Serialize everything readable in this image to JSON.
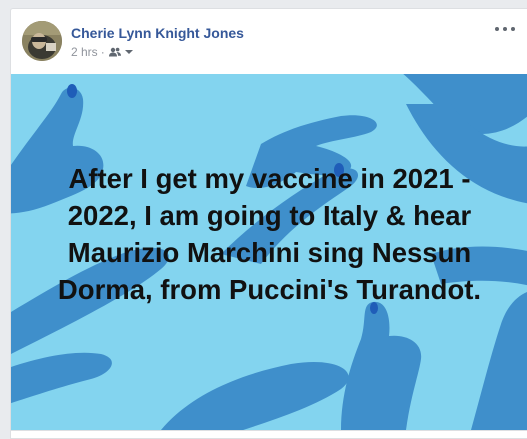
{
  "post": {
    "author": "Cherie Lynn Knight Jones",
    "time": "2 hrs",
    "separator": "·",
    "audience_icon": "friends-icon",
    "more_icon": "more-options-icon",
    "background_text": "After I get my vaccine in 2021 - 2022, I am going to Italy & hear Maurizio Marchini sing Nessun Dorma, from Puccini's Turandot.",
    "background_colors": {
      "base": "#83d4ef",
      "hands": "#3f8fcb",
      "nails": "#1f5db8"
    }
  }
}
